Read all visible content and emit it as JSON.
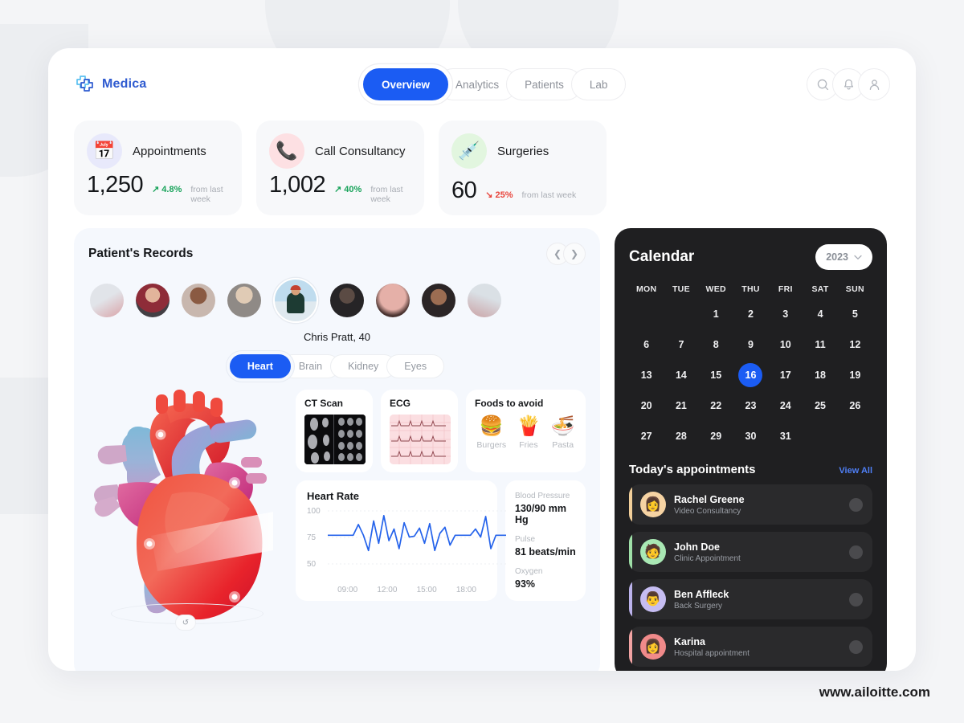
{
  "brand": {
    "name": "Medica",
    "logo_icon": "medical-cross-icon",
    "color": "#2f5bd0"
  },
  "nav": {
    "tabs": [
      {
        "label": "Overview",
        "active": true
      },
      {
        "label": "Analytics",
        "active": false
      },
      {
        "label": "Patients",
        "active": false
      },
      {
        "label": "Lab",
        "active": false
      }
    ]
  },
  "header_actions": [
    {
      "icon": "search-icon"
    },
    {
      "icon": "bell-icon"
    },
    {
      "icon": "user-icon"
    }
  ],
  "stats": [
    {
      "label": "Appointments",
      "value": "1,250",
      "delta": "4.8%",
      "direction": "up",
      "sub": "from last week",
      "icon": "calendar-icon",
      "icon_glyph": "📅",
      "icon_bg": "#e8e9fb"
    },
    {
      "label": "Call Consultancy",
      "value": "1,002",
      "delta": "40%",
      "direction": "up",
      "sub": "from last week",
      "icon": "phone-icon",
      "icon_glyph": "📞",
      "icon_bg": "#fde0e3"
    },
    {
      "label": "Surgeries",
      "value": "60",
      "delta": "25%",
      "direction": "down",
      "sub": "from last week",
      "icon": "syringe-icon",
      "icon_glyph": "💉",
      "icon_bg": "#e2f6df"
    }
  ],
  "patients": {
    "title": "Patient's Records",
    "prev_icon": "chevron-left-icon",
    "next_icon": "chevron-right-icon",
    "selected_name": "Chris Pratt, 40",
    "avatars": [
      {
        "name": "patient-1",
        "color1": "#c9ccd1",
        "color2": "#b73b3f",
        "edge": true
      },
      {
        "name": "patient-2",
        "color1": "#8e2c38",
        "color2": "#433f44"
      },
      {
        "name": "patient-3",
        "color1": "#8a5a42",
        "color2": "#c8b7ae"
      },
      {
        "name": "patient-4",
        "color1": "#cbb9a8",
        "color2": "#8f8a86"
      },
      {
        "name": "patient-chris-pratt",
        "color1": "#bfdcee",
        "color2": "#1d3b33",
        "selected": true
      },
      {
        "name": "patient-6",
        "color1": "#262426",
        "color2": "#5b4b44"
      },
      {
        "name": "patient-7",
        "color1": "#e5b0a8",
        "color2": "#4a3330"
      },
      {
        "name": "patient-8",
        "color1": "#2b2526",
        "color2": "#9c6d52"
      },
      {
        "name": "patient-9",
        "color1": "#b8c2c8",
        "color2": "#963b3b",
        "edge": true
      }
    ]
  },
  "organ_tabs": [
    {
      "label": "Heart",
      "active": true
    },
    {
      "label": "Brain",
      "active": false
    },
    {
      "label": "Kidney",
      "active": false
    },
    {
      "label": "Eyes",
      "active": false
    }
  ],
  "heart_illustration": {
    "name": "anatomical-heart-illustration",
    "badge_icon": "rotate-icon"
  },
  "mini_cards": {
    "ct_scan": {
      "title": "CT Scan",
      "image": "ct-scan-image"
    },
    "ecg": {
      "title": "ECG",
      "image": "ecg-strip-image"
    },
    "foods": {
      "title": "Foods to avoid",
      "items": [
        {
          "label": "Burgers",
          "glyph": "🍔"
        },
        {
          "label": "Fries",
          "glyph": "🍟"
        },
        {
          "label": "Pasta",
          "glyph": "🍜"
        }
      ]
    }
  },
  "vitals": [
    {
      "label": "Blood Pressure",
      "value": "130/90 mm Hg"
    },
    {
      "label": "Pulse",
      "value": "81 beats/min"
    },
    {
      "label": "Oxygen",
      "value": "93%"
    }
  ],
  "chart_data": {
    "type": "line",
    "title": "Heart Rate",
    "xlabel": "",
    "ylabel": "",
    "ylim": [
      40,
      110
    ],
    "yticks": [
      50,
      75,
      100
    ],
    "ytick_labels": [
      "50",
      "75",
      "100"
    ],
    "xtick_labels": [
      "09:00",
      "12:00",
      "15:00",
      "18:00"
    ],
    "grid": true,
    "legend": "none",
    "line_color": "#2563eb",
    "values": [
      81,
      81,
      81,
      81,
      81,
      81,
      93,
      81,
      64,
      97,
      72,
      103,
      75,
      88,
      66,
      95,
      79,
      80,
      89,
      72,
      94,
      64,
      83,
      90,
      70,
      81,
      81,
      81,
      81,
      88,
      79,
      102,
      66,
      81,
      81,
      81
    ]
  },
  "calendar": {
    "title": "Calendar",
    "year": "2023",
    "year_dropdown_icon": "chevron-down-icon",
    "weekdays": [
      "MON",
      "TUE",
      "WED",
      "THU",
      "FRI",
      "SAT",
      "SUN"
    ],
    "leading_blanks": 2,
    "days": [
      1,
      2,
      3,
      4,
      5,
      6,
      7,
      8,
      9,
      10,
      11,
      12,
      13,
      14,
      15,
      16,
      17,
      18,
      19,
      20,
      21,
      22,
      23,
      24,
      25,
      26,
      27,
      28,
      29,
      30,
      31
    ],
    "selected_day": 16,
    "accent": "#1b5cf3"
  },
  "appointments": {
    "title": "Today's appointments",
    "view_all": "View All",
    "items": [
      {
        "name": "Rachel Greene",
        "type": "Video Consultancy",
        "bar_color": "#f2cf9a",
        "avatar_bg": "#f6d3a3",
        "glyph": "👩"
      },
      {
        "name": "John Doe",
        "type": "Clinic Appointment",
        "bar_color": "#9fe0a8",
        "avatar_bg": "#a9e8b4",
        "glyph": "🧑"
      },
      {
        "name": "Ben Affleck",
        "type": "Back Surgery",
        "bar_color": "#bcb3ec",
        "avatar_bg": "#c6bdf2",
        "glyph": "👨"
      },
      {
        "name": "Karina",
        "type": "Hospital appointment",
        "bar_color": "#f2a3a3",
        "avatar_bg": "#f08a8a",
        "glyph": "👩"
      }
    ]
  },
  "footer": {
    "watermark": "www.ailoitte.com"
  }
}
